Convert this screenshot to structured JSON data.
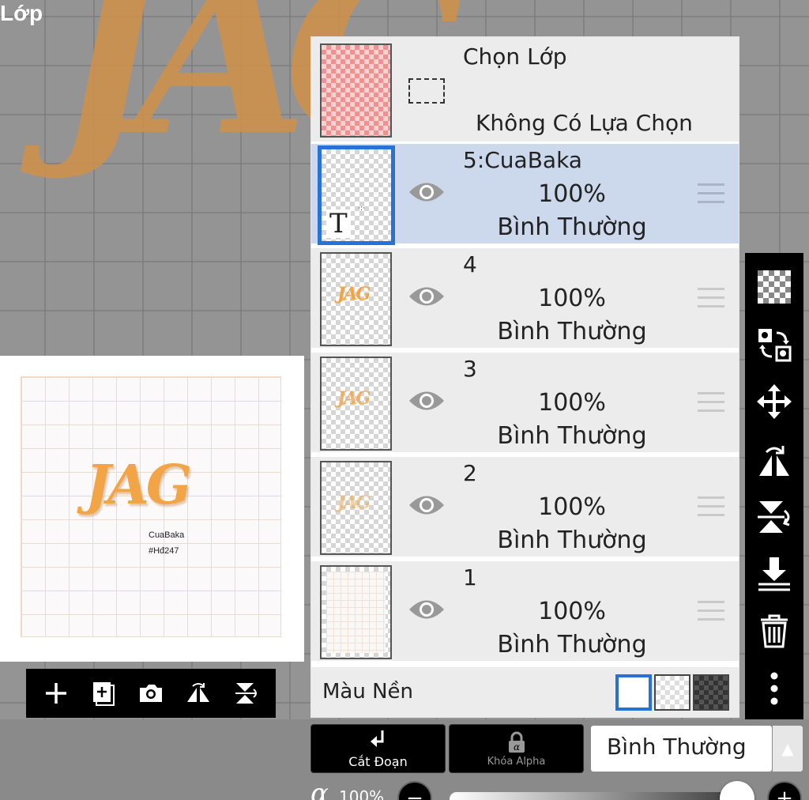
{
  "screen": {
    "title": "Lớp"
  },
  "canvas": {
    "logo_text": "JAG"
  },
  "preview": {
    "logo_text": "JAG",
    "name": "CuaBaka",
    "tag": "#Hđ247"
  },
  "selection": {
    "title": "Chọn Lớp",
    "status": "Không Có Lựa Chọn"
  },
  "layers": [
    {
      "name": "5:CuaBaka",
      "opacity": "100%",
      "blend": "Bình Thường",
      "selected": true,
      "thumb_icon": "T",
      "thumb_dots": "·:·"
    },
    {
      "name": "4",
      "opacity": "100%",
      "blend": "Bình Thường",
      "thumb_logo": "JAG"
    },
    {
      "name": "3",
      "opacity": "100%",
      "blend": "Bình Thường",
      "thumb_logo": "JAG"
    },
    {
      "name": "2",
      "opacity": "100%",
      "blend": "Bình Thường",
      "thumb_logo": "JAG"
    },
    {
      "name": "1",
      "opacity": "100%",
      "blend": "Bình Thường"
    }
  ],
  "background": {
    "label": "Màu Nền"
  },
  "bottom_bar": {
    "clip_label": "Cắt Đoạn",
    "alpha_lock_label": "Khóa Alpha",
    "blend_mode": "Bình Thường",
    "opacity_value": "100%",
    "opacity_level": 1.0
  },
  "colors": {
    "accent": "#2872d6",
    "selected_row": "#ccd9ec",
    "logo_orange": "#f2a546"
  }
}
